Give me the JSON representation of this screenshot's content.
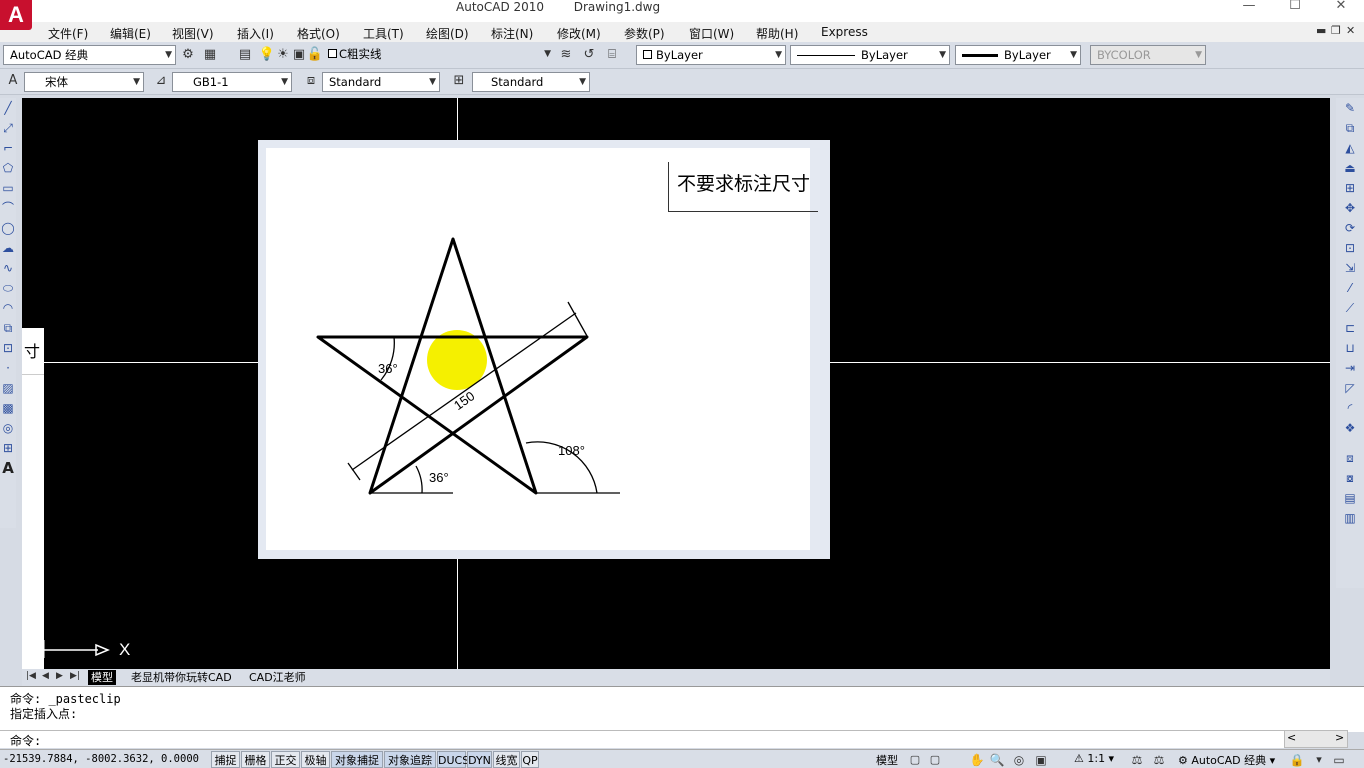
{
  "window": {
    "app_title": "AutoCAD 2010",
    "doc_title": "Drawing1.dwg",
    "logo_letter": "A",
    "minimize_glyph": "—",
    "maximize_glyph": "☐",
    "close_glyph": "✕",
    "doc_minimize": "▬",
    "doc_restore": "❐",
    "doc_close": "✕"
  },
  "menu": [
    "文件(F)",
    "编辑(E)",
    "视图(V)",
    "插入(I)",
    "格式(O)",
    "工具(T)",
    "绘图(D)",
    "标注(N)",
    "修改(M)",
    "参数(P)",
    "窗口(W)",
    "帮助(H)",
    "Express"
  ],
  "toolbar1": {
    "workspace": "AutoCAD 经典",
    "layer": "C粗实线",
    "color": "ByLayer",
    "linetype": "ByLayer",
    "lineweight": "ByLayer",
    "plotstyle": "BYCOLOR"
  },
  "toolbar2": {
    "text_font": "宋体",
    "text_style": "GB1-1",
    "dim_style": "Standard",
    "table_style": "Standard"
  },
  "drawing": {
    "note": "不要求标注尺寸",
    "angle_top": "36°",
    "angle_bottom": "36°",
    "angle_right": "108°",
    "length": "150",
    "highlight_color": "#f5f000"
  },
  "palette_fragment_text": "寸",
  "ucs": {
    "x_label": "X"
  },
  "tabs": {
    "nav": [
      "|◀",
      "◀",
      "▶",
      "▶|"
    ],
    "items": [
      "模型",
      "老显机带你玩转CAD",
      "CAD江老师"
    ]
  },
  "command": {
    "history": [
      "命令:  _pasteclip",
      "指定插入点:"
    ],
    "prompt": "命令:",
    "scroll_left": "<",
    "scroll_right": ">"
  },
  "status": {
    "coords": "-21539.7884, -8002.3632, 0.0000",
    "toggles": [
      {
        "label": "捕捉",
        "on": false
      },
      {
        "label": "栅格",
        "on": false
      },
      {
        "label": "正交",
        "on": false
      },
      {
        "label": "极轴",
        "on": false
      },
      {
        "label": "对象捕捉",
        "on": true
      },
      {
        "label": "对象追踪",
        "on": true
      },
      {
        "label": "DUCS",
        "on": true
      },
      {
        "label": "DYN",
        "on": true
      },
      {
        "label": "线宽",
        "on": false
      },
      {
        "label": "QP",
        "on": false
      }
    ],
    "model": "模型",
    "scale": "1:1",
    "workspace": "AutoCAD 经典"
  }
}
